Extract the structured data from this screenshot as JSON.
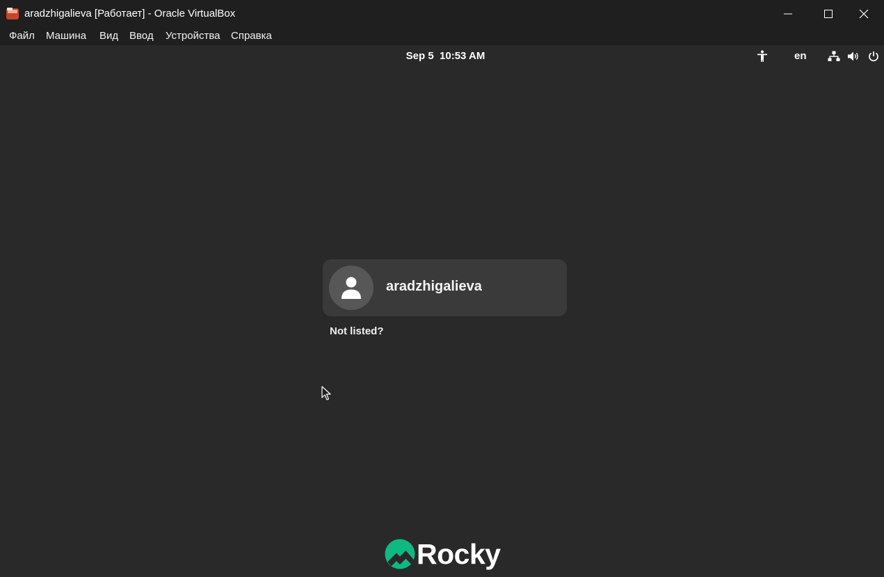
{
  "window": {
    "title": "aradzhigalieva [Работает] - Oracle VirtualBox",
    "icons": {
      "app": "virtualbox-icon",
      "minimize": "minimize-icon",
      "maximize": "maximize-icon",
      "close": "close-icon"
    }
  },
  "menubar": {
    "items": [
      "Файл",
      "Машина",
      "Вид",
      "Ввод",
      "Устройства",
      "Справка"
    ]
  },
  "guest": {
    "topbar": {
      "clock": "Sep 5  10:53 AM",
      "language": "en",
      "icons": [
        "accessibility-icon",
        "network-icon",
        "volume-icon",
        "power-icon"
      ]
    },
    "login": {
      "username": "aradzhigalieva",
      "not_listed": "Not listed?",
      "avatar_icon": "user-avatar-icon"
    },
    "brand": {
      "logo_text": "Rocky"
    }
  },
  "colors": {
    "guest_background": "#292929",
    "card_background": "#3a3a3a",
    "avatar_background": "#575757",
    "rocky_green": "#10b981"
  }
}
